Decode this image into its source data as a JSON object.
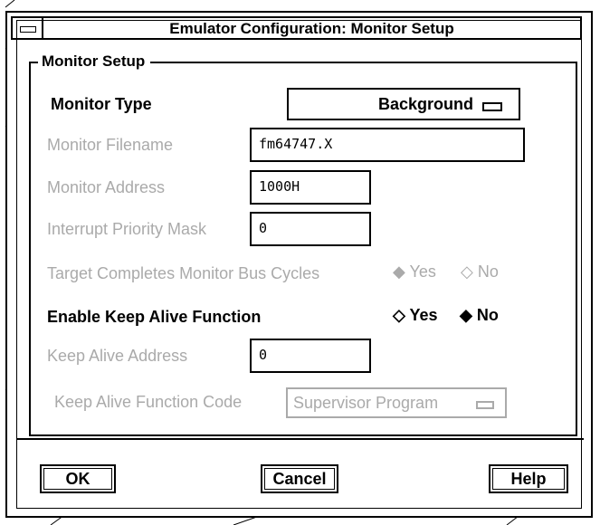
{
  "window": {
    "title": "Emulator Configuration: Monitor Setup"
  },
  "group": {
    "title": "Monitor Setup"
  },
  "monitor_type": {
    "label": "Monitor Type",
    "value": "Background"
  },
  "monitor_filename": {
    "label": "Monitor Filename",
    "value": "fm64747.X"
  },
  "monitor_address": {
    "label": "Monitor Address",
    "value": "1000H"
  },
  "interrupt_mask": {
    "label": "Interrupt Priority Mask",
    "value": "0"
  },
  "target_completes": {
    "label": "Target Completes Monitor Bus Cycles",
    "yes_label": "Yes",
    "no_label": "No",
    "selected": "Yes"
  },
  "keep_alive": {
    "label": "Enable Keep Alive Function",
    "yes_label": "Yes",
    "no_label": "No",
    "selected": "No"
  },
  "keep_alive_address": {
    "label": "Keep Alive Address",
    "value": "0"
  },
  "keep_alive_code": {
    "label": "Keep Alive Function Code",
    "value": "Supervisor Program"
  },
  "buttons": {
    "ok": "OK",
    "cancel": "Cancel",
    "help": "Help"
  },
  "colors": {
    "active_text": "#000000",
    "dimmed_text": "#aaaaaa"
  }
}
